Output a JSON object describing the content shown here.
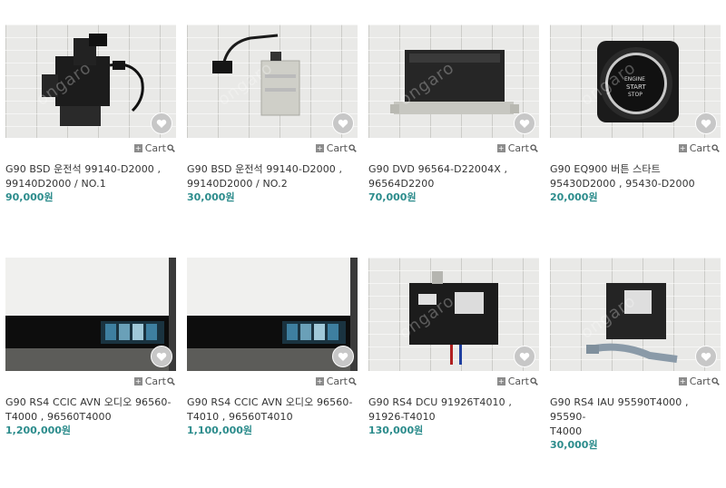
{
  "products": [
    {
      "line1": "G90 BSD 운전석 99140-D2000 ,",
      "line2": "99140D2000 / NO.1",
      "price": "90,000원",
      "cart_label": "Cart"
    },
    {
      "line1": "G90 BSD 운전석 99140-D2000 ,",
      "line2": "99140D2000 / NO.2",
      "price": "30,000원",
      "cart_label": "Cart"
    },
    {
      "line1": "G90 DVD 96564-D22004X ,",
      "line2": "96564D2200",
      "price": "70,000원",
      "cart_label": "Cart"
    },
    {
      "line1": "G90 EQ900 버튼 스타트",
      "line2": "95430D2000 , 95430-D2000",
      "price": "20,000원",
      "cart_label": "Cart"
    },
    {
      "line1": "G90 RS4 CCIC AVN 오디오 96560-",
      "line2": "T4000 , 96560T4000",
      "price": "1,200,000원",
      "cart_label": "Cart"
    },
    {
      "line1": "G90 RS4 CCIC AVN 오디오 96560-",
      "line2": "T4010 , 96560T4010",
      "price": "1,100,000원",
      "cart_label": "Cart"
    },
    {
      "line1": "G90 RS4 DCU 91926T4010 ,",
      "line2": "91926-T4010",
      "price": "130,000원",
      "cart_label": "Cart"
    },
    {
      "line1": "G90 RS4 IAU 95590T4000 , 95590-",
      "line2": "T4000",
      "price": "30,000원",
      "cart_label": "Cart"
    }
  ],
  "watermark": "ongaro",
  "icons": {
    "wishlist": "heart-icon",
    "cart_add": "plus-icon",
    "zoom": "search-icon"
  },
  "colors": {
    "price": "#2c8c8c",
    "heart_bg": "#c7c7c7"
  }
}
